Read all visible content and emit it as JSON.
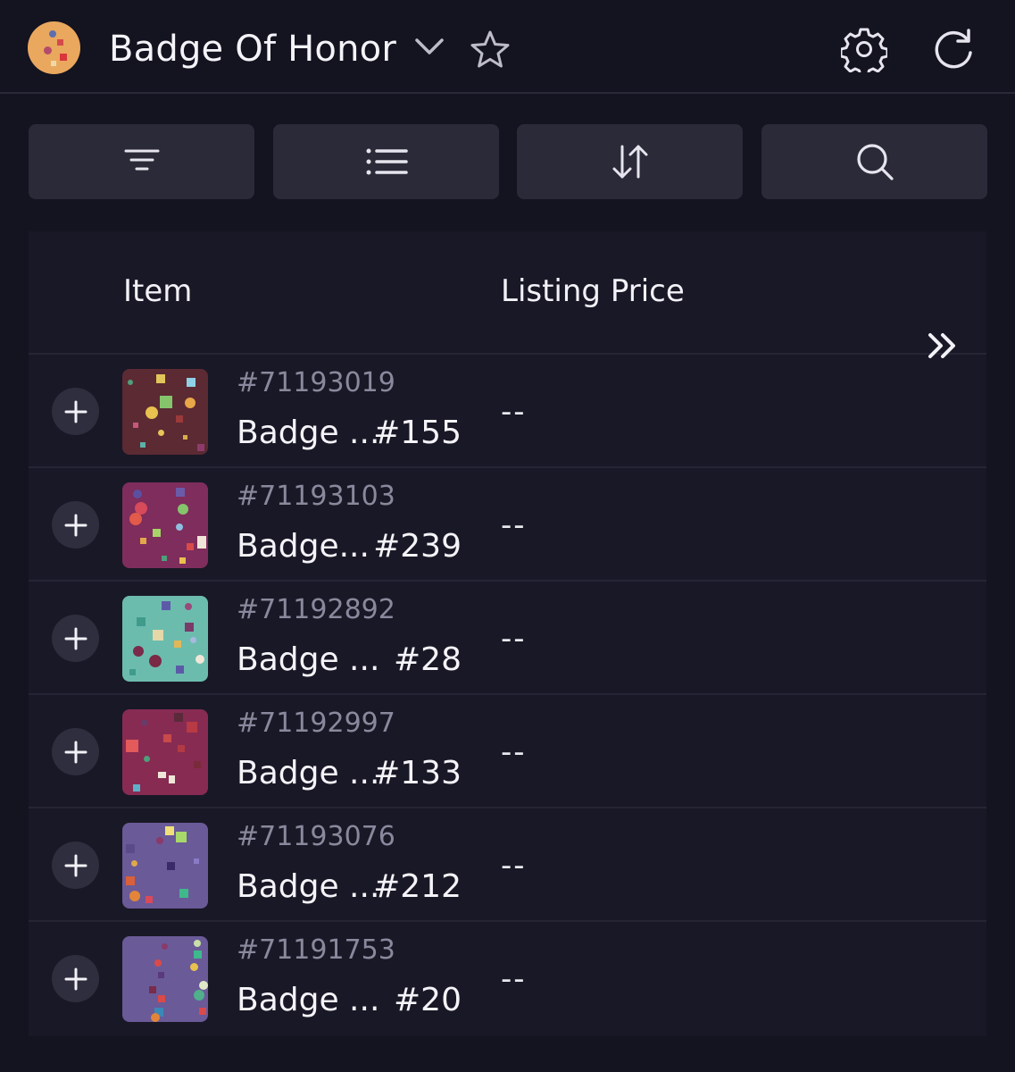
{
  "header": {
    "title": "Badge Of Honor",
    "icons": [
      "collection-avatar",
      "chevron-down-icon",
      "star-icon",
      "gear-icon",
      "refresh-icon"
    ]
  },
  "toolbar": {
    "buttons": [
      {
        "name": "filter-button",
        "icon": "filter-icon"
      },
      {
        "name": "list-view-button",
        "icon": "list-icon"
      },
      {
        "name": "sort-button",
        "icon": "sort-arrows-icon"
      },
      {
        "name": "search-button",
        "icon": "search-icon"
      }
    ]
  },
  "table": {
    "columns": [
      "Item",
      "Listing Price"
    ],
    "expand_icon": "double-chevron-right-icon",
    "rows": [
      {
        "token_id": "#71193019",
        "name": "Badge ...",
        "number": "#155",
        "price": "--",
        "thumb_color": "#5b2a33"
      },
      {
        "token_id": "#71193103",
        "name": "Badge...",
        "number": "#239",
        "price": "--",
        "thumb_color": "#7e2d5c"
      },
      {
        "token_id": "#71192892",
        "name": "Badge ...",
        "number": "#28",
        "price": "--",
        "thumb_color": "#6cbcae"
      },
      {
        "token_id": "#71192997",
        "name": "Badge ...",
        "number": "#133",
        "price": "--",
        "thumb_color": "#872b52"
      },
      {
        "token_id": "#71193076",
        "name": "Badge ...",
        "number": "#212",
        "price": "--",
        "thumb_color": "#6a5a98"
      },
      {
        "token_id": "#71191753",
        "name": "Badge ...",
        "number": "#20",
        "price": "--",
        "thumb_color": "#6a5a98"
      }
    ]
  },
  "colors": {
    "background": "#141320",
    "panel": "#191826",
    "button": "#2b2a39",
    "muted_text": "#8a889c",
    "avatar": "#e9a85e"
  }
}
